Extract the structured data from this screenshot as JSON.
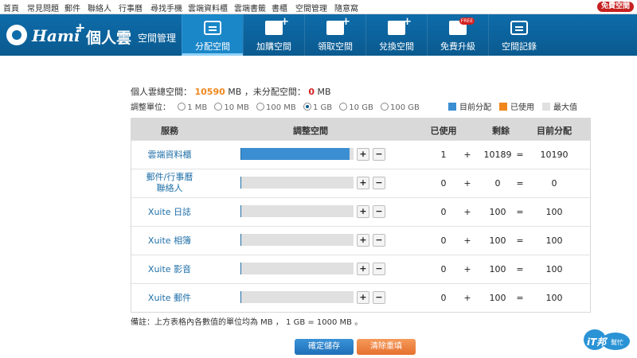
{
  "top_menu": {
    "items": [
      "首頁",
      "常見問題",
      "郵件",
      "聯絡人",
      "行事曆",
      "尋找手機",
      "雲端資料櫃",
      "雲端書籤",
      "書櫃",
      "空間管理",
      "隨意窩"
    ],
    "free_space": "免費空間"
  },
  "header": {
    "logo_hami": "Hami",
    "logo_plus": "+",
    "logo_name": "個人雲",
    "logo_sub": "空間管理",
    "nav": [
      {
        "label": "分配空間",
        "icon": "document-icon",
        "active": true
      },
      {
        "label": "加購空間",
        "icon": "add-storage-icon",
        "active": false
      },
      {
        "label": "領取空間",
        "icon": "receive-storage-icon",
        "active": false
      },
      {
        "label": "兌換空間",
        "icon": "exchange-storage-icon",
        "active": false
      },
      {
        "label": "免費升級",
        "icon": "free-upgrade-icon",
        "active": false
      },
      {
        "label": "空間記錄",
        "icon": "record-icon",
        "active": false
      }
    ]
  },
  "summary": {
    "total_label": "個人雲總空間：",
    "total_value": "10590",
    "unit1": "MB",
    "unalloc_label": "，未分配空間：",
    "unalloc_value": "0",
    "unit2": "MB"
  },
  "units": {
    "label": "調整單位：",
    "options": [
      "1 MB",
      "10 MB",
      "100 MB",
      "1 GB",
      "10 GB",
      "100 GB"
    ],
    "selected": "1 GB"
  },
  "legend": {
    "current": "目前分配",
    "used": "已使用",
    "max": "最大值",
    "current_color": "#3b8ed1",
    "used_color": "#f0861c",
    "max_color": "#e0e0e0"
  },
  "table": {
    "headers": {
      "service": "服務",
      "adjust": "調整空間",
      "used": "已使用",
      "remain": "剩餘",
      "current": "目前分配"
    },
    "plus_label": "+",
    "minus_label": "−",
    "op_plus": "+",
    "op_eq": "=",
    "rows": [
      {
        "service": "雲端資料櫃",
        "service2": "",
        "used": "1",
        "remain": "10189",
        "current": "10190",
        "fill": 0.965
      },
      {
        "service": "郵件/行事曆",
        "service2": "聯絡人",
        "used": "0",
        "remain": "0",
        "current": "0",
        "fill": 0
      },
      {
        "service": "Xuite 日誌",
        "service2": "",
        "used": "0",
        "remain": "100",
        "current": "100",
        "fill": 0
      },
      {
        "service": "Xuite 相簿",
        "service2": "",
        "used": "0",
        "remain": "100",
        "current": "100",
        "fill": 0
      },
      {
        "service": "Xuite 影音",
        "service2": "",
        "used": "0",
        "remain": "100",
        "current": "100",
        "fill": 0
      },
      {
        "service": "Xuite 郵件",
        "service2": "",
        "used": "0",
        "remain": "100",
        "current": "100",
        "fill": 0
      }
    ]
  },
  "note": "備註：上方表格內各數值的單位均為 MB ， 1 GB = 1000 MB 。",
  "buttons": {
    "save": "確定儲存",
    "reset": "清除重填"
  },
  "watermark": {
    "text": "iT邦",
    "sub": "幫忙"
  }
}
